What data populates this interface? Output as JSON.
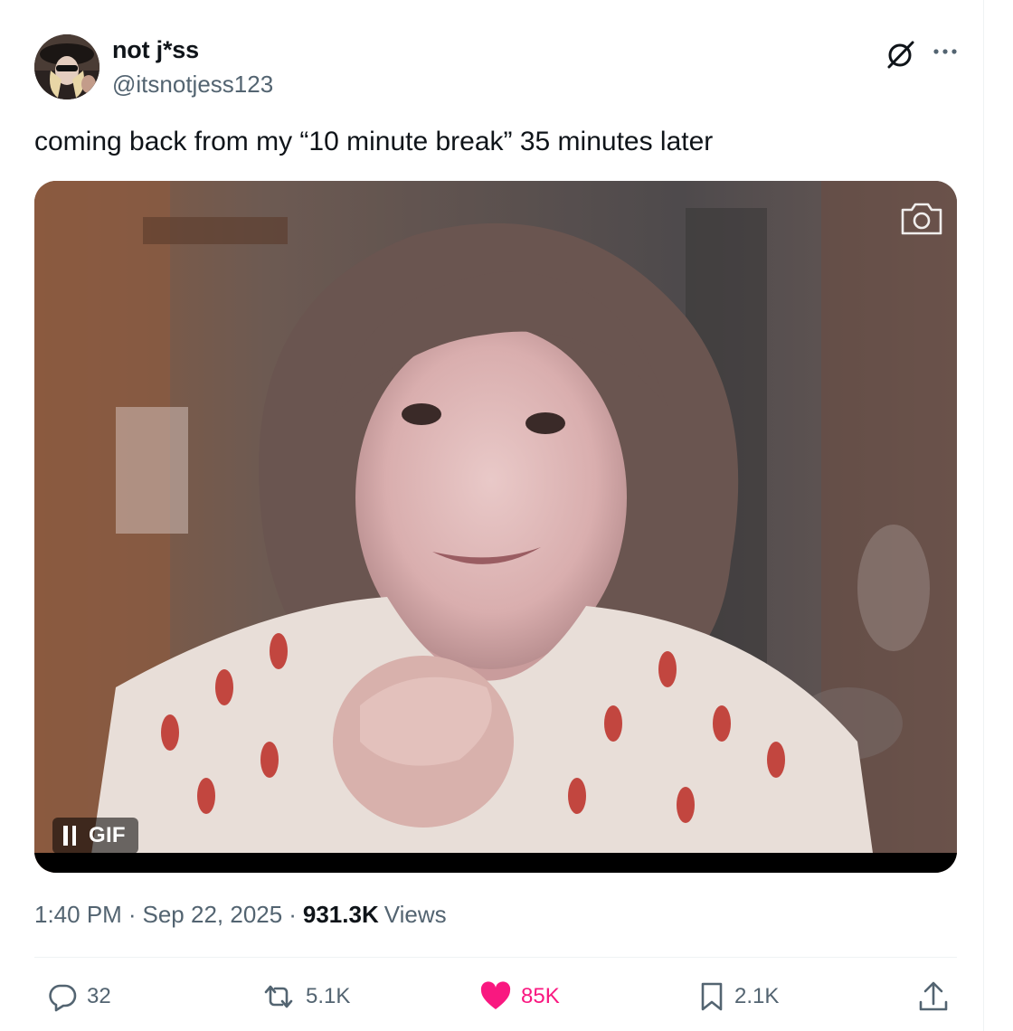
{
  "user": {
    "display_name": "not j*ss",
    "handle": "@itsnotjess123",
    "avatar_icon": "profile-photo"
  },
  "post": {
    "text": "coming back from my “10 minute break” 35 minutes later",
    "media": {
      "type": "GIF",
      "badge_label": "GIF",
      "playback_state": "playing"
    }
  },
  "meta": {
    "time": "1:40 PM",
    "separator": "·",
    "date": "Sep 22, 2025",
    "views_count": "931.3K",
    "views_label": "Views"
  },
  "actions": {
    "reply_count": "32",
    "repost_count": "5.1K",
    "like_count": "85K",
    "bookmark_count": "2.1K"
  },
  "colors": {
    "text_primary": "#0f1419",
    "text_secondary": "#536471",
    "like_active": "#f91880",
    "divider": "#eff3f4"
  }
}
